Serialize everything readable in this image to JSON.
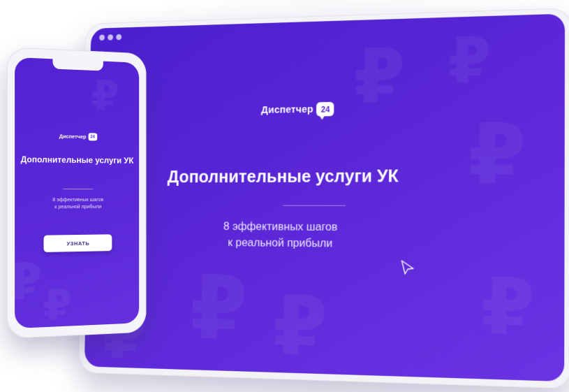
{
  "desktop": {
    "logo": {
      "text": "Диспетчер",
      "badge": "24"
    },
    "headline": "Дополнительные услуги УК",
    "subtitle_line1": "8 эффективных шагов",
    "subtitle_line2": "к реальной прибыли"
  },
  "phone": {
    "logo": {
      "text": "Диспетчер",
      "badge": "24"
    },
    "headline": "Дополнительные услуги УК",
    "subtitle_line1": "8 эффективных шагов",
    "subtitle_line2": "к реальной прибыли",
    "button_label": "УЗНАТЬ"
  },
  "decor": {
    "currency_glyph": "₽"
  },
  "icons": {
    "window_dots": "traffic-light-dots-icon",
    "cursor": "cursor-arrow-icon"
  },
  "colors": {
    "brand_purple": "#5a26d6",
    "brand_purple_light": "#6a34e3",
    "device_frame": "#f3f3f7",
    "button_bg": "#ffffff"
  }
}
